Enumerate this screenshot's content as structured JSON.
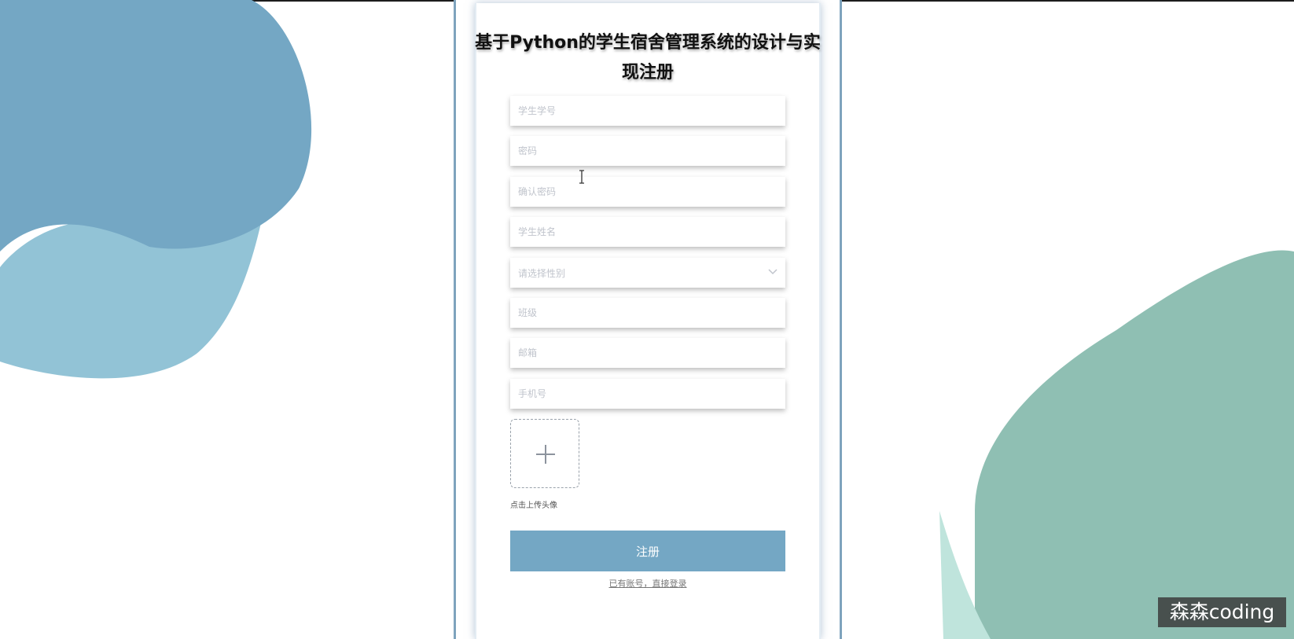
{
  "title": "基于Python的学生宿舍管理系统的设计与实现注册",
  "form": {
    "student_id_placeholder": "学生学号",
    "password_placeholder": "密码",
    "confirm_password_placeholder": "确认密码",
    "student_name_placeholder": "学生姓名",
    "gender_placeholder": "请选择性别",
    "class_placeholder": "班级",
    "email_placeholder": "邮箱",
    "phone_placeholder": "手机号"
  },
  "upload": {
    "label": "点击上传头像",
    "icon": "plus-icon"
  },
  "register_button": "注册",
  "login_link": "已有账号，直接登录",
  "watermark": "森森coding",
  "colors": {
    "button": "#74a7c4",
    "blob_dark_blue": "#74a7c4",
    "blob_light_blue": "#92c3d6",
    "blob_green": "#8fbfb3",
    "frame_border": "#7ea3bd"
  }
}
